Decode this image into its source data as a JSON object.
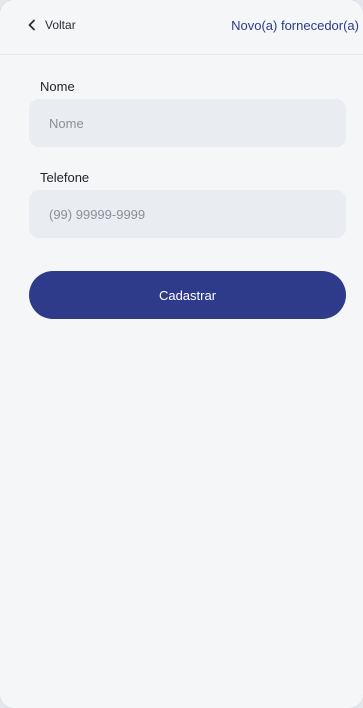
{
  "header": {
    "back_label": "Voltar",
    "back_icon": "chevron-left-icon",
    "title": "Novo(a) fornecedor(a)"
  },
  "form": {
    "name": {
      "label": "Nome",
      "placeholder": "Nome",
      "value": ""
    },
    "phone": {
      "label": "Telefone",
      "placeholder": "(99) 99999-9999",
      "value": ""
    },
    "submit_label": "Cadastrar"
  },
  "colors": {
    "accent": "#2e3b8a",
    "background": "#f4f6f8",
    "input_background": "#e9ecf0"
  }
}
